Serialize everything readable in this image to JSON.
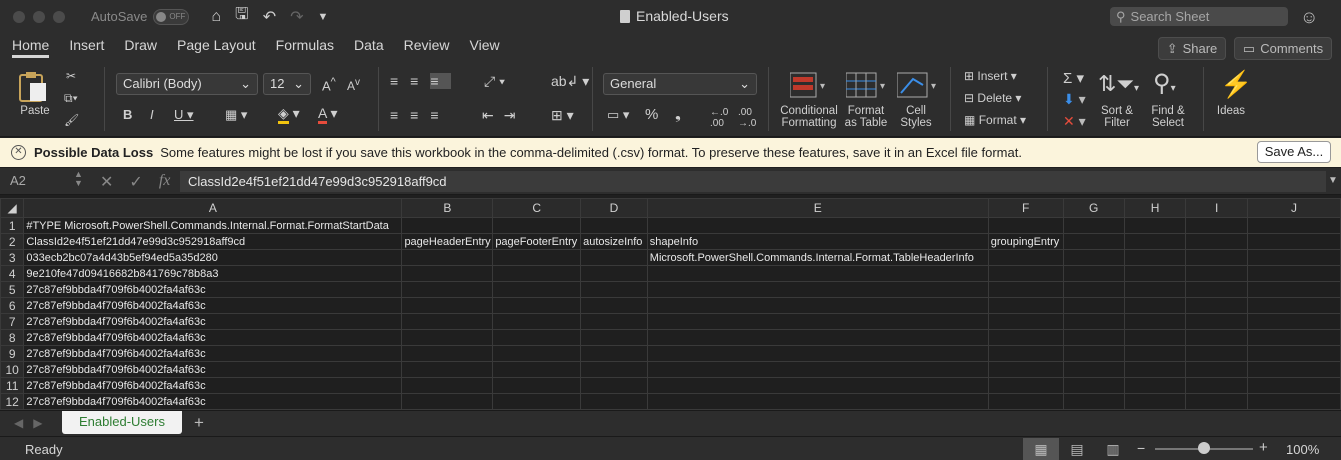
{
  "titlebar": {
    "autosave_label": "AutoSave",
    "autosave_state": "OFF",
    "doc_title": "Enabled-Users",
    "search_placeholder": "Search Sheet"
  },
  "tabs": [
    "Home",
    "Insert",
    "Draw",
    "Page Layout",
    "Formulas",
    "Data",
    "Review",
    "View"
  ],
  "share_label": "Share",
  "comments_label": "Comments",
  "ribbon": {
    "paste_label": "Paste",
    "font_name": "Calibri (Body)",
    "font_size": "12",
    "number_format": "General",
    "cond_fmt_label": "Conditional\nFormatting",
    "format_table_label": "Format\nas Table",
    "cell_styles_label": "Cell\nStyles",
    "insert_label": "Insert",
    "delete_label": "Delete",
    "format_label": "Format",
    "sort_filter_label": "Sort &\nFilter",
    "find_select_label": "Find &\nSelect",
    "ideas_label": "Ideas"
  },
  "notice": {
    "title": "Possible Data Loss",
    "message": "Some features might be lost if you save this workbook in the comma-delimited (.csv) format. To preserve these features, save it in an Excel file format.",
    "button": "Save As..."
  },
  "formula_bar": {
    "name_box": "A2",
    "formula": "ClassId2e4f51ef21dd47e99d3c952918aff9cd"
  },
  "grid": {
    "columns": [
      "A",
      "B",
      "C",
      "D",
      "E",
      "F",
      "G",
      "H",
      "I",
      "J"
    ],
    "rows": [
      {
        "num": "1",
        "cells": [
          "#TYPE Microsoft.PowerShell.Commands.Internal.Format.FormatStartData",
          "",
          "",
          "",
          "",
          "",
          "",
          "",
          "",
          ""
        ]
      },
      {
        "num": "2",
        "cells": [
          "ClassId2e4f51ef21dd47e99d3c952918aff9cd",
          "pageHeaderEntry",
          "pageFooterEntry",
          "autosizeInfo",
          "shapeInfo",
          "groupingEntry",
          "",
          "",
          "",
          ""
        ]
      },
      {
        "num": "3",
        "cells": [
          "033ecb2bc07a4d43b5ef94ed5a35d280",
          "",
          "",
          "",
          "Microsoft.PowerShell.Commands.Internal.Format.TableHeaderInfo",
          "",
          "",
          "",
          "",
          ""
        ]
      },
      {
        "num": "4",
        "cells": [
          "9e210fe47d09416682b841769c78b8a3",
          "",
          "",
          "",
          "",
          "",
          "",
          "",
          "",
          ""
        ]
      },
      {
        "num": "5",
        "cells": [
          "27c87ef9bbda4f709f6b4002fa4af63c",
          "",
          "",
          "",
          "",
          "",
          "",
          "",
          "",
          ""
        ]
      },
      {
        "num": "6",
        "cells": [
          "27c87ef9bbda4f709f6b4002fa4af63c",
          "",
          "",
          "",
          "",
          "",
          "",
          "",
          "",
          ""
        ]
      },
      {
        "num": "7",
        "cells": [
          "27c87ef9bbda4f709f6b4002fa4af63c",
          "",
          "",
          "",
          "",
          "",
          "",
          "",
          "",
          ""
        ]
      },
      {
        "num": "8",
        "cells": [
          "27c87ef9bbda4f709f6b4002fa4af63c",
          "",
          "",
          "",
          "",
          "",
          "",
          "",
          "",
          ""
        ]
      },
      {
        "num": "9",
        "cells": [
          "27c87ef9bbda4f709f6b4002fa4af63c",
          "",
          "",
          "",
          "",
          "",
          "",
          "",
          "",
          ""
        ]
      },
      {
        "num": "10",
        "cells": [
          "27c87ef9bbda4f709f6b4002fa4af63c",
          "",
          "",
          "",
          "",
          "",
          "",
          "",
          "",
          ""
        ]
      },
      {
        "num": "11",
        "cells": [
          "27c87ef9bbda4f709f6b4002fa4af63c",
          "",
          "",
          "",
          "",
          "",
          "",
          "",
          "",
          ""
        ]
      },
      {
        "num": "12",
        "cells": [
          "27c87ef9bbda4f709f6b4002fa4af63c",
          "",
          "",
          "",
          "",
          "",
          "",
          "",
          "",
          ""
        ]
      }
    ]
  },
  "sheet_tab": "Enabled-Users",
  "status": {
    "ready": "Ready",
    "zoom": "100%",
    "zoom_level": 1.0
  },
  "colors": {
    "sheet_tab_text": "#2e7d32",
    "notice_bg": "#fbf4dc",
    "ideas_icon": "#3b8ee8",
    "cond_fmt_red": "#c0392b"
  }
}
